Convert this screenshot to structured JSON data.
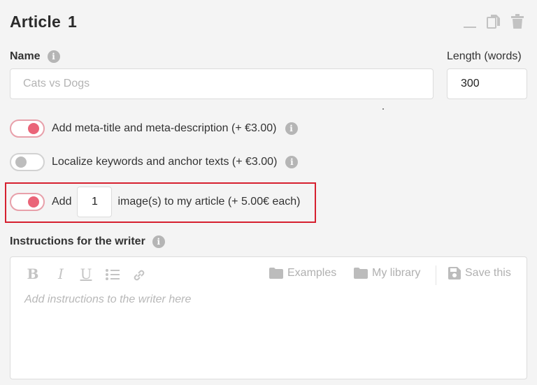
{
  "header": {
    "title": "Article",
    "number": "1"
  },
  "name_field": {
    "label": "Name",
    "placeholder": "Cats vs Dogs"
  },
  "length_field": {
    "label": "Length (words)",
    "value": "300"
  },
  "options": {
    "meta": {
      "label": "Add meta-title and meta-description (+ €3.00)",
      "on": true
    },
    "localize": {
      "label": "Localize keywords and anchor texts (+ €3.00)",
      "on": false
    },
    "images": {
      "prefix": "Add",
      "count": "1",
      "suffix": "image(s) to my article (+ 5.00€ each)",
      "on": true
    }
  },
  "instructions": {
    "label": "Instructions for the writer",
    "placeholder": "Add instructions to the writer here",
    "toolbar": {
      "bold": "B",
      "italic": "I",
      "underline": "U",
      "examples": "Examples",
      "my_library": "My library",
      "save_this": "Save this"
    }
  },
  "colors": {
    "toggle_on": "#ea6478",
    "highlight_border": "#d6202f"
  }
}
